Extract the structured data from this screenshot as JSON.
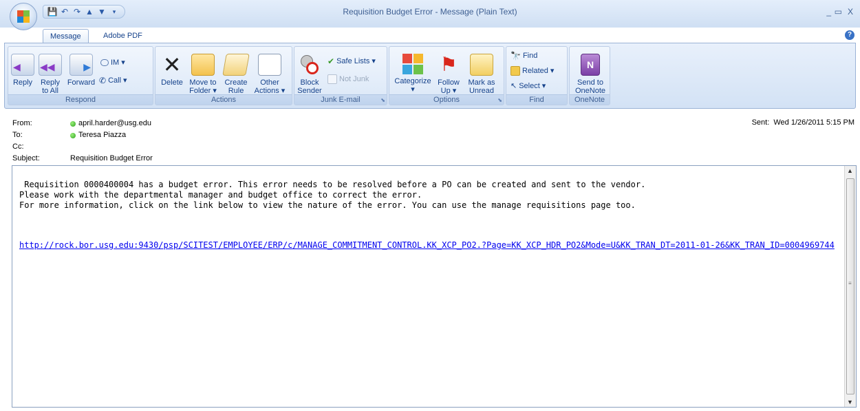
{
  "window": {
    "title": "Requisition Budget Error - Message (Plain Text)",
    "minimize": "_",
    "close": "X"
  },
  "tabs": [
    {
      "label": "Message",
      "active": true
    },
    {
      "label": "Adobe PDF",
      "active": false
    }
  ],
  "ribbon": {
    "respond": {
      "label": "Respond",
      "reply": "Reply",
      "reply_all_1": "Reply",
      "reply_all_2": "to All",
      "forward": "Forward",
      "im": "IM",
      "call": "Call"
    },
    "actions": {
      "label": "Actions",
      "delete": "Delete",
      "move_1": "Move to",
      "move_2": "Folder",
      "create_1": "Create",
      "create_2": "Rule",
      "other_1": "Other",
      "other_2": "Actions"
    },
    "junk": {
      "label": "Junk E-mail",
      "block_1": "Block",
      "block_2": "Sender",
      "safe_lists": "Safe Lists",
      "not_junk": "Not Junk"
    },
    "options": {
      "label": "Options",
      "categorize": "Categorize",
      "follow_1": "Follow",
      "follow_2": "Up",
      "mark_1": "Mark as",
      "mark_2": "Unread"
    },
    "find": {
      "label": "Find",
      "find": "Find",
      "related": "Related",
      "select": "Select"
    },
    "onenote": {
      "label": "OneNote",
      "send_1": "Send to",
      "send_2": "OneNote"
    }
  },
  "header": {
    "from_label": "From:",
    "from_value": "april.harder@usg.edu",
    "to_label": "To:",
    "to_value": "Teresa Piazza",
    "cc_label": "Cc:",
    "subject_label": "Subject:",
    "subject_value": "Requisition Budget Error",
    "sent_label": "Sent:",
    "sent_value": "Wed 1/26/2011 5:15 PM"
  },
  "message": {
    "body": " Requisition 0000400004 has a budget error. This error needs to be resolved before a PO can be created and sent to the vendor.\nPlease work with the departmental manager and budget office to correct the error.\nFor more information, click on the link below to view the nature of the error. You can use the manage requisitions page too.",
    "link": "http://rock.bor.usg.edu:9430/psp/SCITEST/EMPLOYEE/ERP/c/MANAGE_COMMITMENT_CONTROL.KK_XCP_PO2.?Page=KK_XCP_HDR_PO2&Mode=U&KK_TRAN_DT=2011-01-26&KK_TRAN_ID=0004969744"
  },
  "icons": {
    "office": "office-button-icon",
    "save": "save-icon",
    "undo": "undo-icon",
    "redo": "redo-icon",
    "presence": "presence-dot-icon"
  },
  "colors": {
    "ribbon_text": "#15428b",
    "link": "#0000ee",
    "presence": "#2ea21e"
  }
}
